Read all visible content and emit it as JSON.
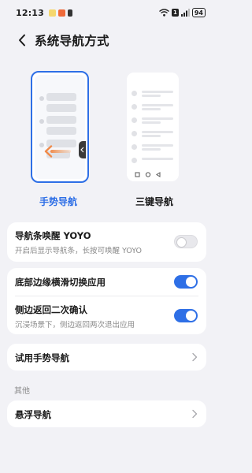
{
  "status_bar": {
    "time": "12:13",
    "sim_label": "1",
    "battery": "94"
  },
  "header": {
    "title": "系统导航方式"
  },
  "navigation_modes": [
    {
      "label": "手势导航",
      "selected": true
    },
    {
      "label": "三键导航",
      "selected": false
    }
  ],
  "settings": {
    "yoyo": {
      "title": "导航条唤醒 YOYO",
      "subtitle": "开启后显示导航条，长按可唤醒 YOYO",
      "enabled": false
    },
    "bottom_swipe": {
      "title": "底部边缘横滑切换应用",
      "enabled": true
    },
    "side_back": {
      "title": "侧边返回二次确认",
      "subtitle": "沉浸场景下，侧边返回两次退出应用",
      "enabled": true
    },
    "try_gesture": {
      "title": "试用手势导航"
    }
  },
  "other_section": {
    "label": "其他",
    "floating_nav": {
      "title": "悬浮导航"
    }
  },
  "colors": {
    "accent": "#2e6fe6",
    "background": "#f2f2f6",
    "arrow_orange": "#f0a36a"
  }
}
